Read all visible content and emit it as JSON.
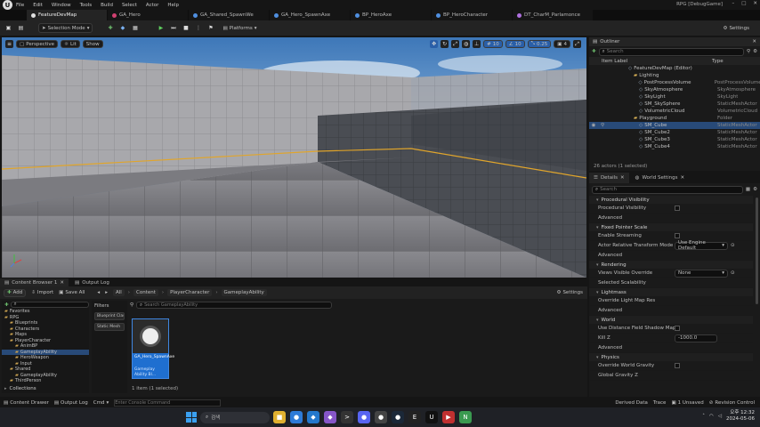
{
  "menu": {
    "items": [
      "File",
      "Edit",
      "Window",
      "Tools",
      "Build",
      "Select",
      "Actor",
      "Help"
    ]
  },
  "doc_tabs": [
    {
      "label": "FeatureDevMap",
      "color": "#e0e0e0",
      "active": true
    },
    {
      "label": "GA_Hero",
      "color": "#d04070"
    },
    {
      "label": "GA_Shared_SpawnWe",
      "color": "#4f8fe0"
    },
    {
      "label": "GA_Hero_SpawnAxe",
      "color": "#4f8fe0"
    },
    {
      "label": "BP_HeroAxe",
      "color": "#4f8fe0"
    },
    {
      "label": "BP_HeroCharacter",
      "color": "#4f8fe0"
    },
    {
      "label": "DT_CharM_Parlamonce",
      "color": "#b070e0"
    }
  ],
  "project_name": "RPG [DebugGame]",
  "toolbar": {
    "mode": "Selection Mode",
    "platforms": "Platforms",
    "settings": "Settings"
  },
  "viewport": {
    "perspective": "Perspective",
    "lit": "Lit",
    "show": "Show",
    "fov": "0.25",
    "grid": "10",
    "angle": "10",
    "scale": "4"
  },
  "outliner": {
    "tab": "Outliner",
    "search_placeholder": "Search",
    "col_item": "Item Label",
    "col_type": "Type",
    "rows": [
      {
        "name": "FeatureDevMap (Editor)",
        "type": "",
        "indent": 0,
        "folder": false
      },
      {
        "name": "Lighting",
        "type": "",
        "indent": 1,
        "folder": true
      },
      {
        "name": "PostProcessVolume",
        "type": "PostProcessVolume",
        "indent": 2,
        "folder": false
      },
      {
        "name": "SkyAtmosphere",
        "type": "SkyAtmosphere",
        "indent": 2,
        "folder": false
      },
      {
        "name": "SkyLight",
        "type": "SkyLight",
        "indent": 2,
        "folder": false
      },
      {
        "name": "SM_SkySphere",
        "type": "StaticMeshActor",
        "indent": 2,
        "folder": false
      },
      {
        "name": "VolumetricCloud",
        "type": "VolumetricCloud",
        "indent": 2,
        "folder": false
      },
      {
        "name": "Playground",
        "type": "Folder",
        "indent": 1,
        "folder": true
      },
      {
        "name": "SM_Cube",
        "type": "StaticMeshActor",
        "indent": 2,
        "folder": false,
        "selected": true
      },
      {
        "name": "SM_Cube2",
        "type": "StaticMeshActor",
        "indent": 2,
        "folder": false
      },
      {
        "name": "SM_Cube3",
        "type": "StaticMeshActor",
        "indent": 2,
        "folder": false
      },
      {
        "name": "SM_Cube4",
        "type": "StaticMeshActor",
        "indent": 2,
        "folder": false
      }
    ],
    "footer": "26 actors (1 selected)"
  },
  "details": {
    "tab_details": "Details",
    "tab_world": "World Settings",
    "search_placeholder": "Search",
    "sections": [
      {
        "header": "Procedural Visibility",
        "props": [
          {
            "key": "Procedural Visibility",
            "control": "checkbox"
          },
          {
            "key": "Advanced",
            "control": "none"
          }
        ]
      },
      {
        "header": "Fixed Pointer Scale",
        "props": [
          {
            "key": "Enable Streaming",
            "control": "checkbox"
          },
          {
            "key": "Actor Relative Transform Mode",
            "control": "select",
            "value": "Use Engine Default"
          },
          {
            "key": "Advanced",
            "control": "none"
          }
        ]
      },
      {
        "header": "Rendering",
        "props": [
          {
            "key": "Views Visible Override",
            "control": "select",
            "value": "None"
          },
          {
            "key": "Selected Scalability",
            "control": "none"
          }
        ]
      },
      {
        "header": "Lightmass",
        "props": [
          {
            "key": "Override Light Map Res",
            "control": "none"
          },
          {
            "key": "Advanced",
            "control": "none"
          }
        ]
      },
      {
        "header": "World",
        "props": [
          {
            "key": "Use Distance Field Shadow Mapping Warnings",
            "control": "checkbox"
          },
          {
            "key": "Kill Z",
            "control": "number",
            "value": "-1000.0"
          },
          {
            "key": "Advanced",
            "control": "none"
          }
        ]
      },
      {
        "header": "Physics",
        "props": [
          {
            "key": "Override World Gravity",
            "control": "checkbox"
          },
          {
            "key": "Global Gravity Z",
            "control": "none"
          }
        ]
      }
    ]
  },
  "bottom_tabs": {
    "content_browser": "Content Browser 1",
    "output_log": "Output Log"
  },
  "content_browser": {
    "add": "Add",
    "import": "Import",
    "save_all": "Save All",
    "path": [
      "All",
      "Content",
      "PlayerCharacter",
      "GameplayAbility"
    ],
    "settings": "Settings",
    "search_placeholder": "Search GameplayAbility",
    "filters_label": "Filters",
    "filter_chips": [
      "Blueprint Class",
      "Static Mesh"
    ],
    "tree": [
      {
        "label": "Favorites",
        "indent": 0
      },
      {
        "label": "RPG",
        "indent": 0
      },
      {
        "label": "Blueprints",
        "indent": 1
      },
      {
        "label": "Characters",
        "indent": 1
      },
      {
        "label": "Maps",
        "indent": 1
      },
      {
        "label": "PlayerCharacter",
        "indent": 1
      },
      {
        "label": "AnimBP",
        "indent": 2
      },
      {
        "label": "GameplayAbility",
        "indent": 2,
        "selected": true
      },
      {
        "label": "HeroWeapon",
        "indent": 2
      },
      {
        "label": "Input",
        "indent": 2
      },
      {
        "label": "Shared",
        "indent": 1
      },
      {
        "label": "GameplayAbility",
        "indent": 2
      },
      {
        "label": "ThirdPerson",
        "indent": 1
      }
    ],
    "collections": "Collections",
    "asset": {
      "name": "GA_Hero_SpawnAxe",
      "type": "Gameplay Ability Bl..."
    },
    "status": "1 item (1 selected)"
  },
  "statusbar": {
    "content_drawer": "Content Drawer",
    "output_log": "Output Log",
    "cmd": "Cmd",
    "cmd_placeholder": "Enter Console Command",
    "derived_data": "Derived Data",
    "trace": "Trace",
    "unsaved": "1 Unsaved",
    "revision": "Revision Control"
  },
  "taskbar": {
    "search_placeholder": "검색",
    "time": "오후 12:32",
    "date": "2024-05-06",
    "apps": [
      {
        "name": "file-explorer",
        "color": "#e0b030",
        "glyph": "■"
      },
      {
        "name": "chrome",
        "color": "#2e7bd8",
        "glyph": "●"
      },
      {
        "name": "vscode",
        "color": "#2478cc",
        "glyph": "◆"
      },
      {
        "name": "visual-studio",
        "color": "#8656c8",
        "glyph": "◆"
      },
      {
        "name": "terminal",
        "color": "#333",
        "glyph": ">"
      },
      {
        "name": "discord",
        "color": "#5865f2",
        "glyph": "●"
      },
      {
        "name": "github",
        "color": "#444",
        "glyph": "●"
      },
      {
        "name": "steam",
        "color": "#1b2838",
        "glyph": "●"
      },
      {
        "name": "epic",
        "color": "#222",
        "glyph": "E"
      },
      {
        "name": "unreal",
        "color": "#111",
        "glyph": "U"
      },
      {
        "name": "media",
        "color": "#c03030",
        "glyph": "▶"
      },
      {
        "name": "notepad",
        "color": "#3a9a50",
        "glyph": "N"
      }
    ]
  }
}
